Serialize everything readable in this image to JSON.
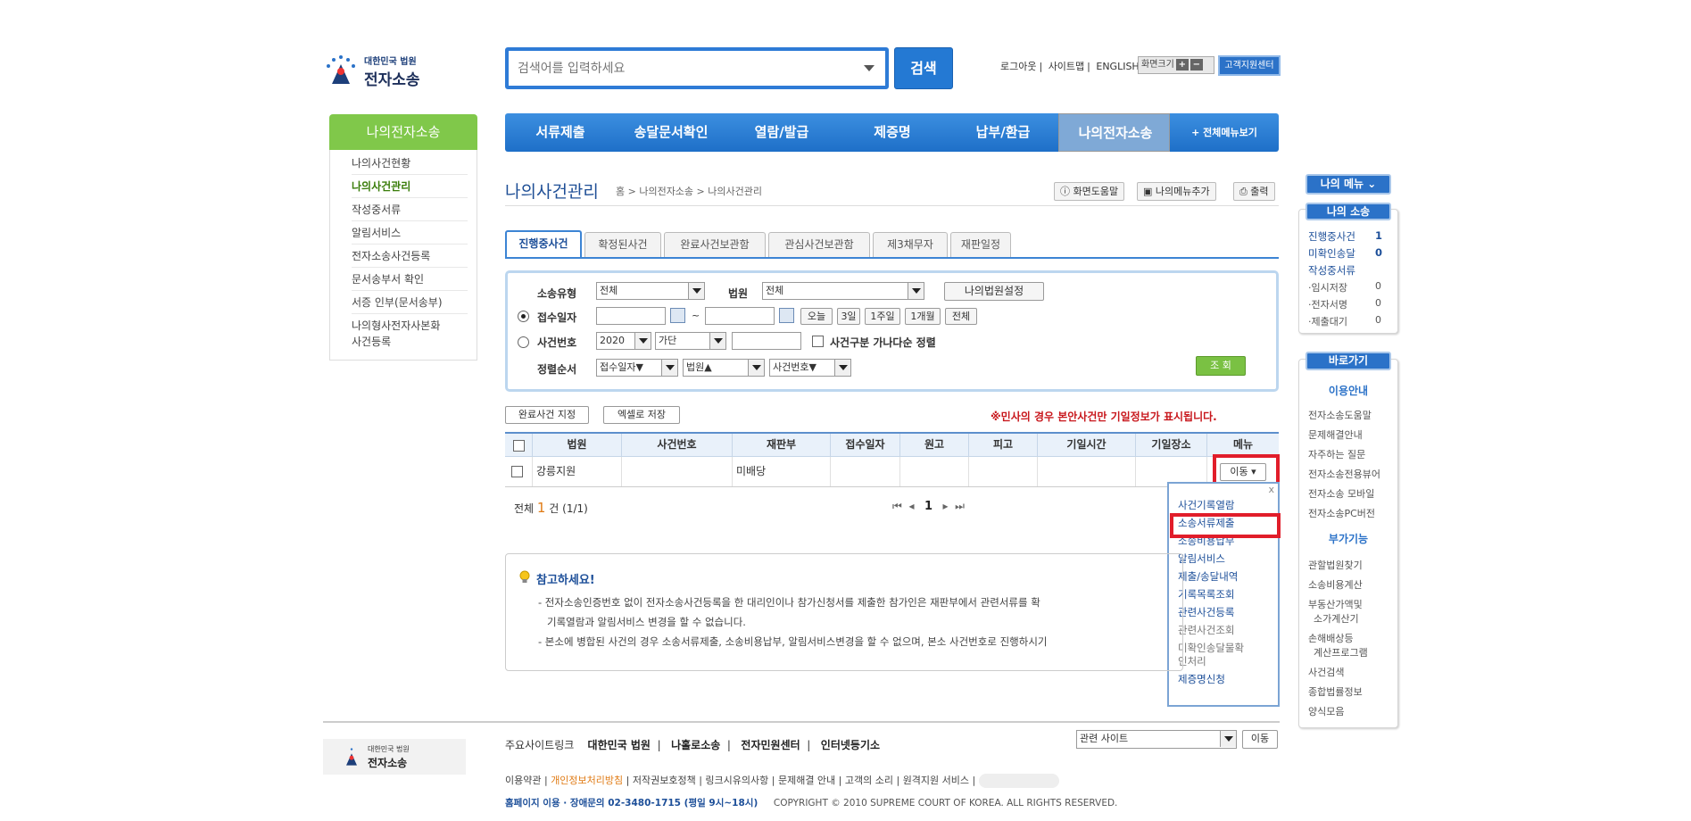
{
  "header": {
    "logo_top": "대한민국 법원",
    "logo_main": "전자소송",
    "search_placeholder": "검색어를 입력하세요",
    "search_button": "검색",
    "links": [
      "로그아웃",
      "사이트맵",
      "ENGLISH"
    ],
    "zoom_label": "화면크기",
    "zoom_plus": "+",
    "zoom_minus": "−",
    "customer_center": "고객지원센터"
  },
  "left_menu": {
    "title": "나의전자소송",
    "items": [
      "나의사건현황",
      "나의사건관리",
      "작성중서류",
      "알림서비스",
      "전자소송사건등록",
      "문서송부서 확인",
      "서증 인부(문서송부)",
      "나의형사전자사본화",
      "사건등록"
    ]
  },
  "gnb": {
    "items": [
      "서류제출",
      "송달문서확인",
      "열람/발급",
      "제증명",
      "납부/환급",
      "나의전자소송"
    ],
    "all_menu": "+ 전체메뉴보기"
  },
  "page": {
    "title": "나의사건관리",
    "breadcrumb": "홈 > 나의전자소송 > 나의사건관리",
    "tools": [
      "화면도움말",
      "나의메뉴추가",
      "출력"
    ]
  },
  "tabs": [
    "진행중사건",
    "확정된사건",
    "완료사건보관함",
    "관심사건보관함",
    "제3채무자",
    "재판일정"
  ],
  "form": {
    "case_type_label": "소송유형",
    "case_type_value": "전체",
    "court_label": "법원",
    "court_value": "전체",
    "my_court_button": "나의법원설정",
    "receipt_date_label": "접수일자",
    "date_sep": "~",
    "date_buttons": [
      "오늘",
      "3일",
      "1주일",
      "1개월",
      "전체"
    ],
    "case_number_label": "사건번호",
    "year_value": "2020",
    "gubun_value": "가단",
    "sort_check_label": "사건구분 가나다순 정렬",
    "sort_order_label": "정렬순서",
    "sort1": "접수일자▼",
    "sort2": "법원▲",
    "sort3": "사건번호▼",
    "query_button": "조 회"
  },
  "actions": {
    "complete_button": "완료사건 지정",
    "excel_button": "엑셀로 저장",
    "notice": "※민사의 경우 본안사건만 기일정보가 표시됩니다."
  },
  "table": {
    "headers": [
      "법원",
      "사건번호",
      "재판부",
      "접수일자",
      "원고",
      "피고",
      "기일시간",
      "기일장소",
      "메뉴"
    ],
    "rows": [
      {
        "court": "강릉지원",
        "case_no": "",
        "division": "미배당",
        "date": "",
        "plaintiff": "",
        "defendant": "",
        "time": "",
        "place": "",
        "menu": "이동"
      }
    ],
    "total_prefix": "전체",
    "total_count": "1",
    "total_suffix": "건 (1/1)",
    "page_number": "1"
  },
  "popup": {
    "close": "x",
    "items": [
      "사건기록열람",
      "소송서류제출",
      "소송비용납부",
      "알림서비스",
      "제출/송달내역",
      "기록목록조회",
      "관련사건등록",
      "관련사건조회",
      "미확인송달물확",
      "인처리",
      "제증명신청"
    ]
  },
  "help": {
    "title": "참고하세요!",
    "lines": [
      "- 전자소송인증번호 없이 전자소송사건등록을 한 대리인이나 참가신청서를 제출한 참가인은 재판부에서 관련서류를 확",
      "기록열람과 알림서비스 변경을 할 수 없습니다.",
      "- 본소에 병합된 사건의 경우 소송서류제출, 소송비용납부, 알림서비스변경을 할 수 없으며, 본소 사건번호로 진행하시기"
    ]
  },
  "right": {
    "my_menu": "나의 메뉴",
    "my_case_title": "나의 소송",
    "case_items": [
      {
        "label": "진행중사건",
        "count": "1"
      },
      {
        "label": "미확인송달",
        "count": "0"
      },
      {
        "label": "작성중서류",
        "count": ""
      }
    ],
    "draft_items": [
      {
        "label": "·임시저장",
        "count": "0"
      },
      {
        "label": "·전자서명",
        "count": "0"
      },
      {
        "label": "·제출대기",
        "count": "0"
      }
    ],
    "shortcut": "바로가기",
    "guide_title": "이용안내",
    "guide_items": [
      "전자소송도움말",
      "문제해결안내",
      "자주하는 질문",
      "전자소송전용뷰어",
      "전자소송 모바일",
      "전자소송PC버전"
    ],
    "extra_title": "부가기능",
    "extra_items": [
      "관할법원찾기",
      "소송비용계산",
      "부동산가액및",
      "소가계산기",
      "손해배상등",
      "계산프로그램",
      "사건검색",
      "종합법률정보",
      "양식모음"
    ]
  },
  "footer": {
    "logo_top": "대한민국 법원",
    "logo_main": "전자소송",
    "links_label": "주요사이트링크",
    "links": [
      "대한민국 법원",
      "나홀로소송",
      "전자민원센터",
      "인터넷등기소"
    ],
    "related_site": "관련 사이트",
    "go": "이동",
    "line2": [
      "이용약관",
      "개인정보처리방침",
      "저작권보호정책",
      "링크시유의사항",
      "문제해결 안내",
      "고객의 소리",
      "원격지원 서비스"
    ],
    "phone": "홈페이지 이용 · 장애문의  02-3480-1715  (평일 9시~18시)",
    "copyright": "COPYRIGHT © 2010 SUPREME COURT OF KOREA. ALL RIGHTS RESERVED."
  }
}
